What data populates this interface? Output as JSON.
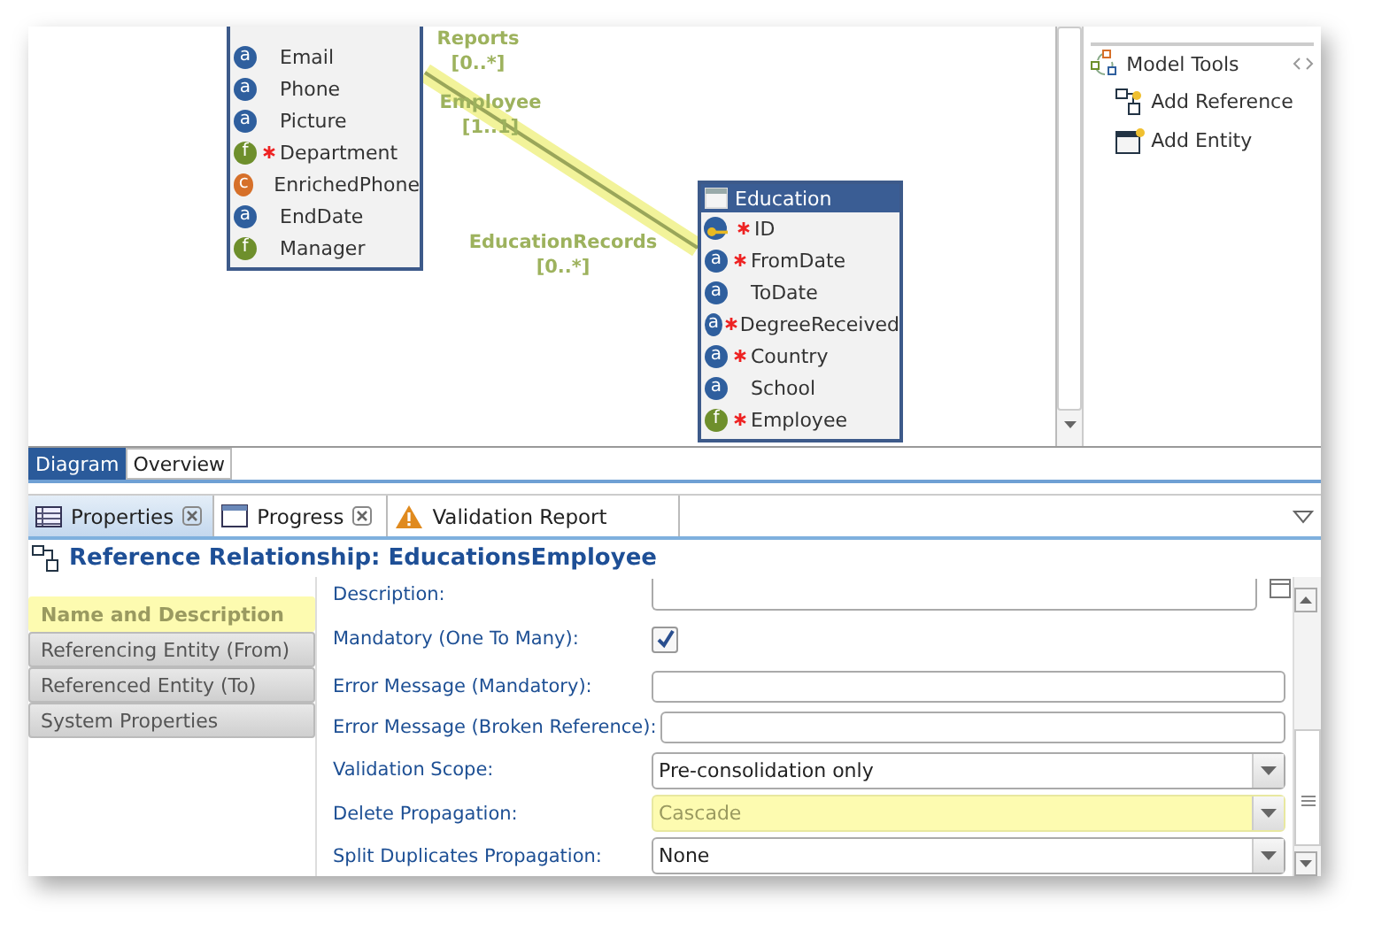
{
  "diagram": {
    "entities": [
      {
        "fields": [
          {
            "name": "Email",
            "kind": "attribute",
            "glyph": "a",
            "required": false
          },
          {
            "name": "Phone",
            "kind": "attribute",
            "glyph": "a",
            "required": false
          },
          {
            "name": "Picture",
            "kind": "attribute",
            "glyph": "a",
            "required": false
          },
          {
            "name": "Department",
            "kind": "reference",
            "glyph": "f",
            "required": true
          },
          {
            "name": "EnrichedPhone",
            "kind": "calculated",
            "glyph": "c",
            "required": false
          },
          {
            "name": "EndDate",
            "kind": "attribute",
            "glyph": "a",
            "required": false
          },
          {
            "name": "Manager",
            "kind": "reference",
            "glyph": "f",
            "required": false
          }
        ]
      },
      {
        "title": "Education",
        "fields": [
          {
            "name": "ID",
            "kind": "key",
            "required": true
          },
          {
            "name": "FromDate",
            "kind": "attribute",
            "glyph": "a",
            "required": true
          },
          {
            "name": "ToDate",
            "kind": "attribute",
            "glyph": "a",
            "required": false
          },
          {
            "name": "DegreeReceived",
            "kind": "attribute",
            "glyph": "a",
            "required": true
          },
          {
            "name": "Country",
            "kind": "attribute",
            "glyph": "a",
            "required": true
          },
          {
            "name": "School",
            "kind": "attribute",
            "glyph": "a",
            "required": false
          },
          {
            "name": "Employee",
            "kind": "reference",
            "glyph": "f",
            "required": true
          }
        ]
      }
    ],
    "relationship": {
      "selected": true,
      "labels": [
        {
          "name": "Reports",
          "cardinality": "[0..*]"
        },
        {
          "name": "Employee",
          "cardinality": "[1..1]"
        },
        {
          "name": "EducationRecords",
          "cardinality": "[0..*]"
        }
      ]
    }
  },
  "palette": {
    "group": "Model Tools",
    "items": [
      {
        "label": "Add Reference",
        "kind": "reference"
      },
      {
        "label": "Add Entity",
        "kind": "entity"
      }
    ]
  },
  "editor_tabs": [
    {
      "label": "Diagram",
      "selected": true
    },
    {
      "label": "Overview",
      "selected": false
    }
  ],
  "view_tabs": [
    {
      "label": "Properties",
      "kind": "properties",
      "selected": true,
      "closable": true
    },
    {
      "label": "Progress",
      "kind": "progress",
      "selected": false,
      "closable": true
    },
    {
      "label": "Validation Report",
      "kind": "warning",
      "selected": false,
      "closable": false
    }
  ],
  "properties": {
    "title": "Reference Relationship: EducationsEmployee",
    "sections": [
      {
        "label": "Name and Description",
        "selected": true
      },
      {
        "label": "Referencing Entity (From)",
        "selected": false
      },
      {
        "label": "Referenced Entity (To)",
        "selected": false
      },
      {
        "label": "System Properties",
        "selected": false
      }
    ],
    "fields": [
      {
        "kind": "textarea",
        "label": "Description:"
      },
      {
        "kind": "checkbox",
        "label": "Mandatory (One To Many):",
        "checked": true
      },
      {
        "kind": "text",
        "label": "Error Message (Mandatory):"
      },
      {
        "kind": "text",
        "label": "Error Message (Broken Reference):"
      },
      {
        "kind": "select",
        "label": "Validation Scope:",
        "value": "Pre-consolidation only",
        "highlighted": false
      },
      {
        "kind": "select",
        "label": "Delete Propagation:",
        "value": "Cascade",
        "highlighted": true
      },
      {
        "kind": "select",
        "label": "Split Duplicates Propagation:",
        "value": "None",
        "highlighted": false
      }
    ]
  }
}
